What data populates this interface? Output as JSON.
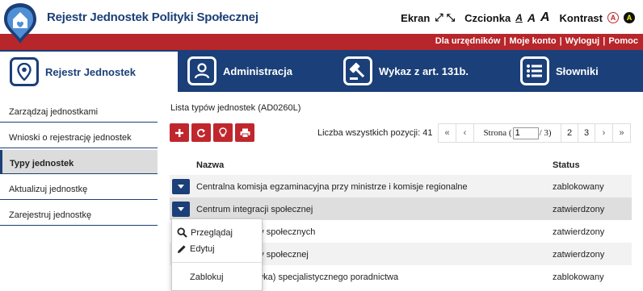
{
  "header": {
    "title": "Rejestr Jednostek Polityki Społecznej",
    "ekran_label": "Ekran",
    "czcionka_label": "Czcionka",
    "font_sizes": [
      "A",
      "A",
      "A"
    ],
    "kontrast_label": "Kontrast",
    "kontrast_options": [
      "A",
      "A"
    ]
  },
  "user_links": [
    "Dla urzędników",
    "Moje konto",
    "Wyloguj",
    "Pomoc"
  ],
  "tabs": [
    {
      "label": "Rejestr Jednostek",
      "icon": "map-pin-icon",
      "active": true
    },
    {
      "label": "Administracja",
      "icon": "user-icon",
      "active": false
    },
    {
      "label": "Wykaz z art. 131b.",
      "icon": "gavel-icon",
      "active": false
    },
    {
      "label": "Słowniki",
      "icon": "list-icon",
      "active": false
    }
  ],
  "sidebar": {
    "items": [
      {
        "label": "Zarządzaj jednostkami",
        "active": false
      },
      {
        "label": "Wnioski o rejestrację jednostek",
        "active": false
      },
      {
        "label": "Typy jednostek",
        "active": true
      },
      {
        "label": "Aktualizuj jednostkę",
        "active": false
      },
      {
        "label": "Zarejestruj jednostkę",
        "active": false
      }
    ]
  },
  "main": {
    "list_title": "Lista typów jednostek (AD0260L)",
    "toolbar_icons": [
      "plus-icon",
      "refresh-icon",
      "lightbulb-icon",
      "print-icon"
    ],
    "count_label": "Liczba wszystkich pozycji: 41",
    "pager": {
      "first": "«",
      "prev": "‹",
      "strona_label": "Strona (",
      "current_page": "1",
      "total_label": "/ 3)",
      "pages": [
        "2",
        "3"
      ],
      "next": "›",
      "last": "»"
    },
    "columns": {
      "name": "Nazwa",
      "status": "Status"
    },
    "rows": [
      {
        "name": "Centralna komisja egzaminacyjna przy ministrze i komisje regionalne",
        "status": "zablokowany"
      },
      {
        "name": "Centrum integracji społecznej",
        "status": "zatwierdzony"
      },
      {
        "name": "Centrum pomocy społecznych",
        "status": "zatwierdzony"
      },
      {
        "name": "Centrum pomocy społecznej",
        "status": "zatwierdzony"
      },
      {
        "name": "Centrum (placówka) specjalistycznego poradnictwa",
        "status": "zablokowany"
      }
    ]
  },
  "context_menu": {
    "items": [
      {
        "label": "Przeglądaj",
        "icon": "search-icon"
      },
      {
        "label": "Edytuj",
        "icon": "pencil-icon"
      },
      {
        "label": "Zablokuj",
        "icon": ""
      }
    ]
  },
  "colors": {
    "navy": "#1b3f78",
    "red": "#b7262b"
  }
}
